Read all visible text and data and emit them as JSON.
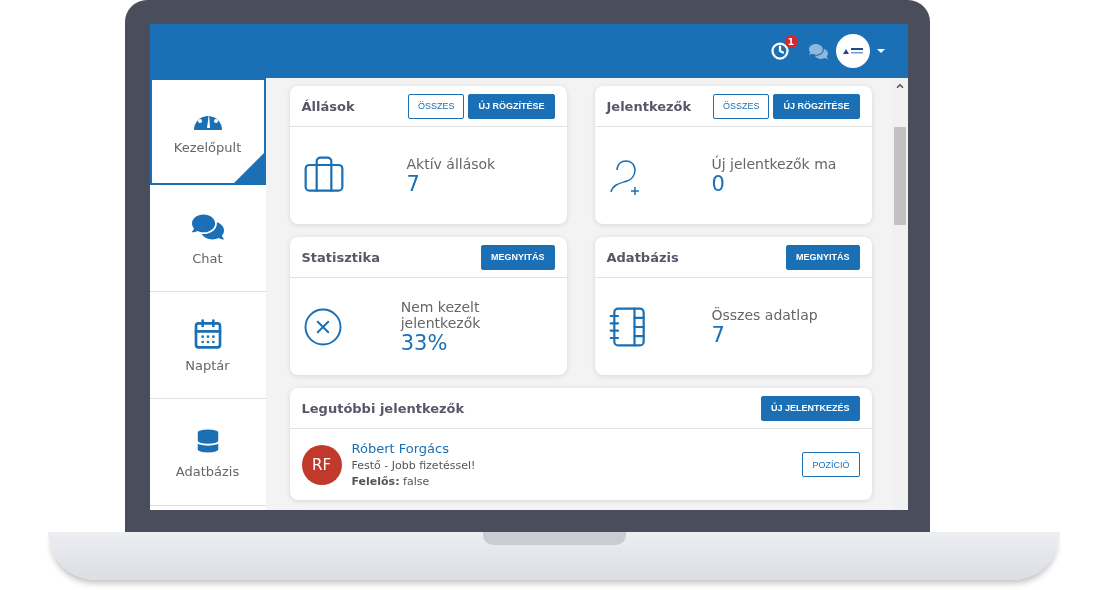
{
  "topbar": {
    "notification_count": "1"
  },
  "sidebar": {
    "items": [
      {
        "label": "Kezelőpult",
        "selected": true
      },
      {
        "label": "Chat",
        "selected": false
      },
      {
        "label": "Naptár",
        "selected": false
      },
      {
        "label": "Adatbázis",
        "selected": false
      }
    ]
  },
  "cards": [
    {
      "title": "Állások",
      "buttons": [
        {
          "label": "ÖSSZES",
          "kind": "outline"
        },
        {
          "label": "ÚJ RÖGZÍTÉSE",
          "kind": "solid"
        }
      ],
      "label": "Aktív állások",
      "value": "7"
    },
    {
      "title": "Jelentkezők",
      "buttons": [
        {
          "label": "ÖSSZES",
          "kind": "outline"
        },
        {
          "label": "ÚJ RÖGZÍTÉSE",
          "kind": "solid"
        }
      ],
      "label": "Új jelentkezők ma",
      "value": "0"
    },
    {
      "title": "Statisztika",
      "buttons": [
        {
          "label": "MEGNYITÁS",
          "kind": "solid"
        }
      ],
      "label": "Nem kezelt jelentkezők",
      "value": "33%"
    },
    {
      "title": "Adatbázis",
      "buttons": [
        {
          "label": "MEGNYITÁS",
          "kind": "solid"
        }
      ],
      "label": "Összes adatlap",
      "value": "7"
    }
  ],
  "recent": {
    "title": "Legutóbbi jelentkezők",
    "button": "ÚJ JELENTKEZÉS",
    "applicants": [
      {
        "initials": "RF",
        "color": "#c0392b",
        "name": "Róbert Forgács",
        "position": "Festő - Jobb fizetéssel!",
        "responsible": "**Felelős:** false",
        "button": "POZÍCIÓ"
      }
    ]
  }
}
